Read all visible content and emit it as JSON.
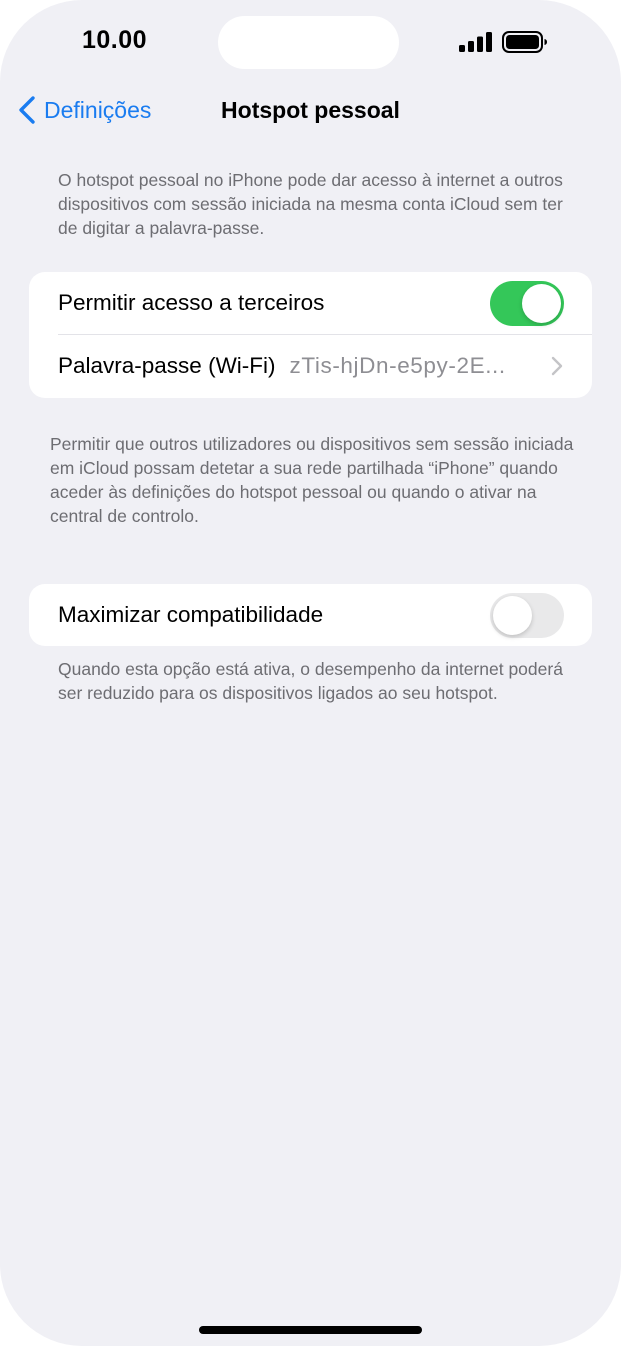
{
  "status_bar": {
    "time": "10.00",
    "icons": [
      "cellular-signal-icon",
      "battery-icon"
    ]
  },
  "nav": {
    "back_label": "Definições",
    "title": "Hotspot pessoal"
  },
  "descriptions": {
    "top": "O hotspot pessoal no iPhone pode dar acesso à internet a outros dispositivos com sessão iniciada na mesma conta iCloud sem ter de digitar a palavra-passe.",
    "middle": "Permitir que outros utilizadores ou dispositivos sem sessão iniciada em iCloud possam detetar a sua rede partilhada “iPhone” quando aceder às definições do hotspot pessoal ou quando o ativar na central de controlo.",
    "bottom": "Quando esta opção está ativa, o desempenho da internet poderá ser reduzido para os dispositivos ligados ao seu hotspot."
  },
  "group1": {
    "allow_others_label": "Permitir acesso a terceiros",
    "allow_others_on": true,
    "password_label": "Palavra-passe (Wi-Fi)",
    "password_value": "zTis-hjDn-e5py-2E..."
  },
  "group2": {
    "maximize_label": "Maximizar compatibilidade",
    "maximize_on": false
  },
  "colors": {
    "accent": "#1a7cf0",
    "toggle_on": "#34c759",
    "toggle_off": "#e9e9ea",
    "background": "#f0f0f5"
  }
}
